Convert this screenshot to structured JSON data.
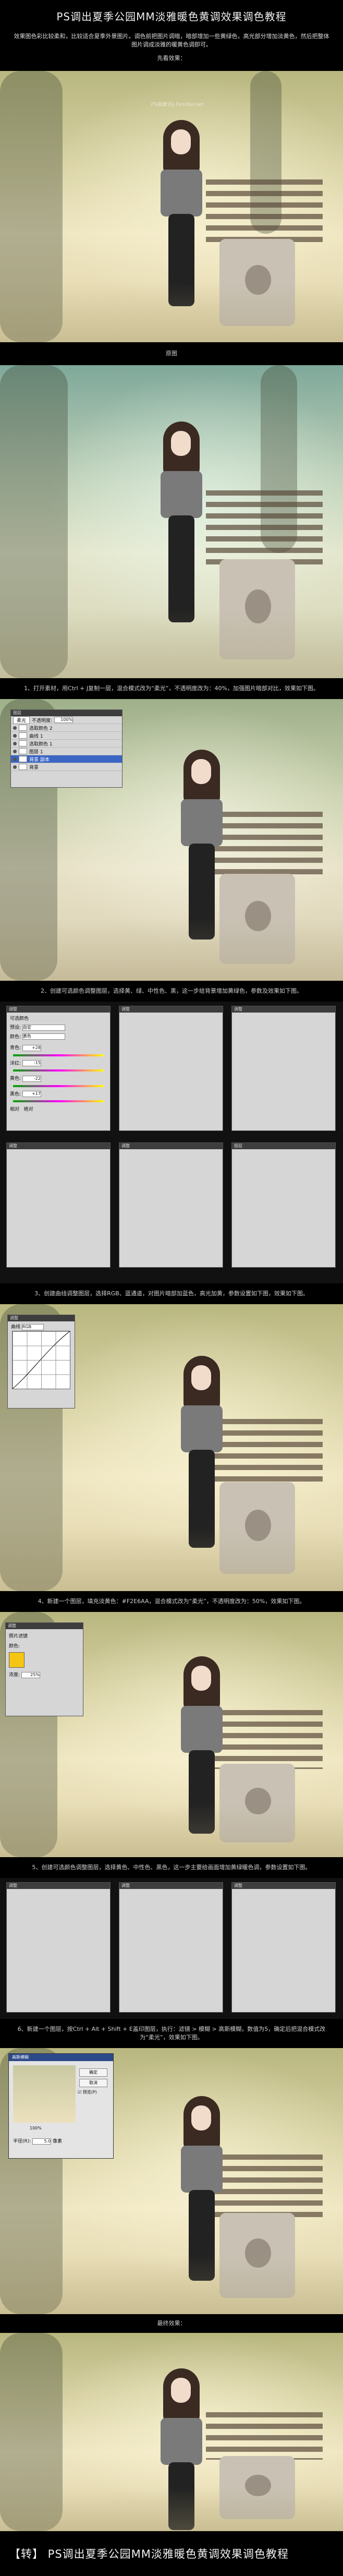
{
  "header": {
    "title": "PS调出夏季公园MM淡雅暖色黄调效果调色教程",
    "intro": "效果图色彩比较柔和，比较适合夏季外景图片。调色前把图片调暗，暗部增加一些黄绿色，高光部分增加淡黄色，然后把整体图片调成淡雅的暖黄色调即可。",
    "intro_2": "先看效果："
  },
  "captions": {
    "original": "原图",
    "step1": "1、打开素材，用Ctrl + J复制一层，混合模式改为“柔光”，不透明度改为：40%，加强图片暗部对比，效果如下图。",
    "step2": "2、创建可选颜色调整图层，选择黄、绿、中性色、黑，这一步给背景增加黄绿色，参数及效果如下图。",
    "step3": "3、创建曲线调整图层，选择RGB、蓝通道，对图片暗部加蓝色，高光加黄，参数设置如下图，效果如下图。",
    "step4": "4、新建一个图层，填充淡黄色：#F2E6AA，混合模式改为“柔光”，不透明度改为：50%，效果如下图。",
    "step5": "5、创建可选颜色调整图层，选择黄色、中性色、黑色，这一步主要给画面增加黄绿暖色调，参数设置如下图。",
    "step6": "6、新建一个图层，按Ctrl + Alt + Shift + E盖印图层，执行：滤镜 > 模糊 > 高斯模糊，数值为5，确定后把混合模式改为“柔光”，效果如下图。",
    "final": "最终效果：",
    "footer": "【转】 PS调出夏季公园MM淡雅暖色黄调效果调色教程"
  },
  "watermark": "PS联盟 By Fanzhai.net",
  "layers_panel": {
    "title": "图层",
    "blend_mode": "柔光",
    "opacity_label": "不透明度:",
    "opacity_value": "100%",
    "rows": [
      "选取颜色 2",
      "曲线 1",
      "选取颜色 1",
      "图层 1",
      "背景 副本",
      "背景"
    ]
  },
  "selective_color": {
    "title": "调整",
    "panel_name": "可选颜色",
    "preset_label": "预设:",
    "preset_value": "自定",
    "colors_label": "颜色:",
    "colors_value": "黄色",
    "labels": [
      "青色:",
      "洋红:",
      "黄色:",
      "黑色:"
    ],
    "values": [
      "+28",
      "-15",
      "-22",
      "+17"
    ],
    "method_relative": "相对",
    "method_absolute": "绝对"
  },
  "curves": {
    "title": "调整",
    "panel_name": "曲线",
    "channel": "RGB"
  },
  "solid": {
    "panel_name": "照片滤镜",
    "filter_label": "颜色:",
    "density_label": "浓度:",
    "density_value": "25%"
  },
  "blur_dialog": {
    "title": "高斯模糊",
    "ok": "确定",
    "cancel": "取消",
    "preview": "预览(P)",
    "zoom": "100%",
    "radius_label": "半径(R):",
    "radius_value": "5.0",
    "unit": "像素"
  }
}
